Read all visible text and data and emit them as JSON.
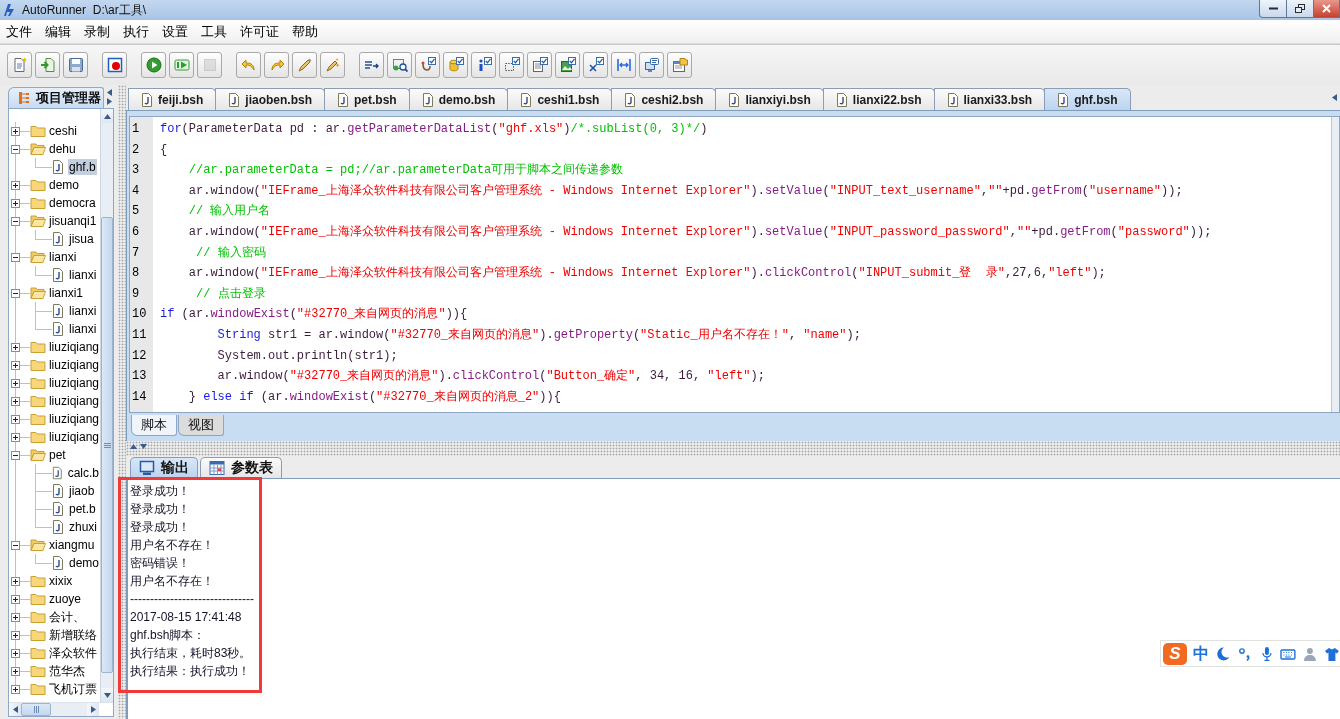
{
  "window": {
    "title": "AutoRunner  D:\\ar工具\\"
  },
  "menu": [
    "文件",
    "编辑",
    "录制",
    "执行",
    "设置",
    "工具",
    "许可证",
    "帮助"
  ],
  "toolbar": [
    [
      {
        "disabled": false
      },
      {
        "disabled": false
      },
      {
        "disabled": false
      }
    ],
    [
      {
        "disabled": false
      }
    ],
    [
      {
        "disabled": false
      },
      {
        "disabled": false
      },
      {
        "disabled": true
      }
    ],
    [
      {
        "disabled": false
      },
      {
        "disabled": false
      },
      {
        "disabled": false
      },
      {
        "disabled": false
      }
    ],
    [
      {
        "disabled": false
      },
      {
        "disabled": false
      },
      {
        "disabled": false
      },
      {
        "disabled": false
      },
      {
        "disabled": false
      },
      {
        "disabled": false
      },
      {
        "disabled": false
      },
      {
        "disabled": false
      },
      {
        "disabled": false
      },
      {
        "disabled": false
      },
      {
        "disabled": false
      },
      {
        "disabled": false
      }
    ]
  ],
  "project_panel": {
    "tab": "项目管理器",
    "tree": [
      {
        "label": "ceshi",
        "kind": "folder",
        "expanded": false,
        "selected": false
      },
      {
        "label": "dehu",
        "kind": "folder",
        "expanded": true,
        "selected": false,
        "children": [
          {
            "label": "ghf.b",
            "kind": "file",
            "selected": true
          }
        ]
      },
      {
        "label": "demo",
        "kind": "folder",
        "expanded": false,
        "selected": false
      },
      {
        "label": "democra",
        "kind": "folder",
        "expanded": false,
        "selected": false
      },
      {
        "label": "jisuanqi1",
        "kind": "folder",
        "expanded": true,
        "selected": false,
        "children": [
          {
            "label": "jisua",
            "kind": "file",
            "selected": false
          }
        ]
      },
      {
        "label": "lianxi",
        "kind": "folder",
        "expanded": true,
        "selected": false,
        "children": [
          {
            "label": "lianxi",
            "kind": "file",
            "selected": false
          }
        ]
      },
      {
        "label": "lianxi1",
        "kind": "folder",
        "expanded": true,
        "selected": false,
        "children": [
          {
            "label": "lianxi",
            "kind": "file",
            "selected": false
          },
          {
            "label": "lianxi",
            "kind": "file",
            "selected": false
          }
        ]
      },
      {
        "label": "liuziqiang",
        "kind": "folder",
        "expanded": false,
        "selected": false
      },
      {
        "label": "liuziqiang",
        "kind": "folder",
        "expanded": false,
        "selected": false
      },
      {
        "label": "liuziqiang",
        "kind": "folder",
        "expanded": false,
        "selected": false
      },
      {
        "label": "liuziqiang",
        "kind": "folder",
        "expanded": false,
        "selected": false
      },
      {
        "label": "liuziqiang",
        "kind": "folder",
        "expanded": false,
        "selected": false
      },
      {
        "label": "liuziqiang",
        "kind": "folder",
        "expanded": false,
        "selected": false
      },
      {
        "label": "pet",
        "kind": "folder",
        "expanded": true,
        "selected": false,
        "children": [
          {
            "label": "calc.b",
            "kind": "file",
            "selected": false
          },
          {
            "label": "jiaob",
            "kind": "file",
            "selected": false
          },
          {
            "label": "pet.b",
            "kind": "file",
            "selected": false
          },
          {
            "label": "zhuxi",
            "kind": "file",
            "selected": false
          }
        ]
      },
      {
        "label": "xiangmu",
        "kind": "folder",
        "expanded": true,
        "selected": false,
        "children": [
          {
            "label": "demo",
            "kind": "file",
            "selected": false
          }
        ]
      },
      {
        "label": "xixix",
        "kind": "folder",
        "expanded": false,
        "selected": false
      },
      {
        "label": "zuoye",
        "kind": "folder",
        "expanded": false,
        "selected": false
      },
      {
        "label": "会计、",
        "kind": "folder",
        "expanded": false,
        "selected": false
      },
      {
        "label": "新增联络",
        "kind": "folder",
        "expanded": false,
        "selected": false
      },
      {
        "label": "泽众软件",
        "kind": "folder",
        "expanded": false,
        "selected": false
      },
      {
        "label": "范华杰",
        "kind": "folder",
        "expanded": false,
        "selected": false
      },
      {
        "label": "飞机订票",
        "kind": "folder",
        "expanded": false,
        "selected": false
      }
    ]
  },
  "editor_tabs": [
    {
      "label": "feiji.bsh",
      "selected": false
    },
    {
      "label": "jiaoben.bsh",
      "selected": false
    },
    {
      "label": "pet.bsh",
      "selected": false
    },
    {
      "label": "demo.bsh",
      "selected": false
    },
    {
      "label": "ceshi1.bsh",
      "selected": false
    },
    {
      "label": "ceshi2.bsh",
      "selected": false
    },
    {
      "label": "lianxiyi.bsh",
      "selected": false
    },
    {
      "label": "lianxi22.bsh",
      "selected": false
    },
    {
      "label": "lianxi33.bsh",
      "selected": false
    },
    {
      "label": "ghf.bsh",
      "selected": true
    }
  ],
  "code": [
    {
      "number": "1",
      "segments": [
        {
          "kind": "keyword",
          "text": "for"
        },
        {
          "kind": "plain",
          "text": "(ParameterData pd : ar."
        },
        {
          "kind": "method",
          "text": "getParameterDataList"
        },
        {
          "kind": "plain",
          "text": "("
        },
        {
          "kind": "string",
          "text": "\"ghf.xls\""
        },
        {
          "kind": "plain",
          "text": ")"
        },
        {
          "kind": "comment",
          "text": "/*.subList(0, 3)*/"
        },
        {
          "kind": "plain",
          "text": ")"
        }
      ]
    },
    {
      "number": "2",
      "segments": [
        {
          "kind": "plain",
          "text": "{"
        }
      ]
    },
    {
      "number": "3",
      "segments": [
        {
          "kind": "comment",
          "text": "    //ar.parameterData = pd;//ar.parameterData可用于脚本之间传递参数"
        }
      ]
    },
    {
      "number": "4",
      "segments": [
        {
          "kind": "plain",
          "text": "    ar.window("
        },
        {
          "kind": "string",
          "text": "\"IEFrame_上海泽众软件科技有限公司客户管理系统 - Windows Internet Explorer\""
        },
        {
          "kind": "plain",
          "text": ")."
        },
        {
          "kind": "method",
          "text": "setValue"
        },
        {
          "kind": "plain",
          "text": "("
        },
        {
          "kind": "string",
          "text": "\"INPUT_text_username\""
        },
        {
          "kind": "plain",
          "text": ","
        },
        {
          "kind": "string",
          "text": "\"\""
        },
        {
          "kind": "plain",
          "text": "+pd."
        },
        {
          "kind": "method",
          "text": "getFrom"
        },
        {
          "kind": "plain",
          "text": "("
        },
        {
          "kind": "string",
          "text": "\"username\""
        },
        {
          "kind": "plain",
          "text": "));"
        }
      ]
    },
    {
      "number": "5",
      "segments": [
        {
          "kind": "comment",
          "text": "    // 输入用户名"
        }
      ]
    },
    {
      "number": "6",
      "segments": [
        {
          "kind": "plain",
          "text": "    ar.window("
        },
        {
          "kind": "string",
          "text": "\"IEFrame_上海泽众软件科技有限公司客户管理系统 - Windows Internet Explorer\""
        },
        {
          "kind": "plain",
          "text": ")."
        },
        {
          "kind": "method",
          "text": "setValue"
        },
        {
          "kind": "plain",
          "text": "("
        },
        {
          "kind": "string",
          "text": "\"INPUT_password_password\""
        },
        {
          "kind": "plain",
          "text": ","
        },
        {
          "kind": "string",
          "text": "\"\""
        },
        {
          "kind": "plain",
          "text": "+pd."
        },
        {
          "kind": "method",
          "text": "getFrom"
        },
        {
          "kind": "plain",
          "text": "("
        },
        {
          "kind": "string",
          "text": "\"password\""
        },
        {
          "kind": "plain",
          "text": "));"
        }
      ]
    },
    {
      "number": "7",
      "segments": [
        {
          "kind": "comment",
          "text": "     // 输入密码"
        }
      ]
    },
    {
      "number": "8",
      "segments": [
        {
          "kind": "plain",
          "text": "    ar.window("
        },
        {
          "kind": "string",
          "text": "\"IEFrame_上海泽众软件科技有限公司客户管理系统 - Windows Internet Explorer\""
        },
        {
          "kind": "plain",
          "text": ")."
        },
        {
          "kind": "method",
          "text": "clickControl"
        },
        {
          "kind": "plain",
          "text": "("
        },
        {
          "kind": "string",
          "text": "\"INPUT_submit_登  录\""
        },
        {
          "kind": "plain",
          "text": ",27,6,"
        },
        {
          "kind": "string",
          "text": "\"left\""
        },
        {
          "kind": "plain",
          "text": ");"
        }
      ]
    },
    {
      "number": "9",
      "segments": [
        {
          "kind": "comment",
          "text": "     // 点击登录"
        }
      ]
    },
    {
      "number": "10",
      "segments": [
        {
          "kind": "keyword",
          "text": "if"
        },
        {
          "kind": "plain",
          "text": " (ar."
        },
        {
          "kind": "method",
          "text": "windowExist"
        },
        {
          "kind": "plain",
          "text": "("
        },
        {
          "kind": "string",
          "text": "\"#32770_来自网页的消息\""
        },
        {
          "kind": "plain",
          "text": ")){"
        }
      ]
    },
    {
      "number": "11",
      "segments": [
        {
          "kind": "keyword",
          "text": "        String"
        },
        {
          "kind": "plain",
          "text": " str1 = ar.window("
        },
        {
          "kind": "string",
          "text": "\"#32770_来自网页的消息\""
        },
        {
          "kind": "plain",
          "text": ")."
        },
        {
          "kind": "method",
          "text": "getProperty"
        },
        {
          "kind": "plain",
          "text": "("
        },
        {
          "kind": "string",
          "text": "\"Static_用户名不存在！\""
        },
        {
          "kind": "plain",
          "text": ", "
        },
        {
          "kind": "string",
          "text": "\"name\""
        },
        {
          "kind": "plain",
          "text": ");"
        }
      ]
    },
    {
      "number": "12",
      "segments": [
        {
          "kind": "plain",
          "text": "        System.out.println(str1);"
        }
      ]
    },
    {
      "number": "13",
      "segments": [
        {
          "kind": "plain",
          "text": "        ar.window("
        },
        {
          "kind": "string",
          "text": "\"#32770_来自网页的消息\""
        },
        {
          "kind": "plain",
          "text": ")."
        },
        {
          "kind": "method",
          "text": "clickControl"
        },
        {
          "kind": "plain",
          "text": "("
        },
        {
          "kind": "string",
          "text": "\"Button_确定\""
        },
        {
          "kind": "plain",
          "text": ", 34, 16, "
        },
        {
          "kind": "string",
          "text": "\"left\""
        },
        {
          "kind": "plain",
          "text": ");"
        }
      ]
    },
    {
      "number": "14",
      "segments": [
        {
          "kind": "plain",
          "text": "    } "
        },
        {
          "kind": "keyword",
          "text": "else if"
        },
        {
          "kind": "plain",
          "text": " (ar."
        },
        {
          "kind": "method",
          "text": "windowExist"
        },
        {
          "kind": "plain",
          "text": "("
        },
        {
          "kind": "string",
          "text": "\"#32770_来自网页的消息_2\""
        },
        {
          "kind": "plain",
          "text": ")){"
        }
      ]
    }
  ],
  "view_tabs": [
    {
      "label": "脚本",
      "selected": true
    },
    {
      "label": "视图",
      "selected": false
    }
  ],
  "output_tabs": [
    {
      "label": "输出",
      "selected": true
    },
    {
      "label": "参数表",
      "selected": false
    }
  ],
  "output": [
    "登录成功！",
    "登录成功！",
    "登录成功！",
    "用户名不存在！",
    "密码错误！",
    "用户名不存在！",
    "-------------------------------",
    "2017-08-15 17:41:48",
    "ghf.bsh脚本：",
    "执行结束，耗时83秒。",
    "执行结果：执行成功！"
  ],
  "ime": {
    "logo": "S",
    "mode": "中"
  }
}
